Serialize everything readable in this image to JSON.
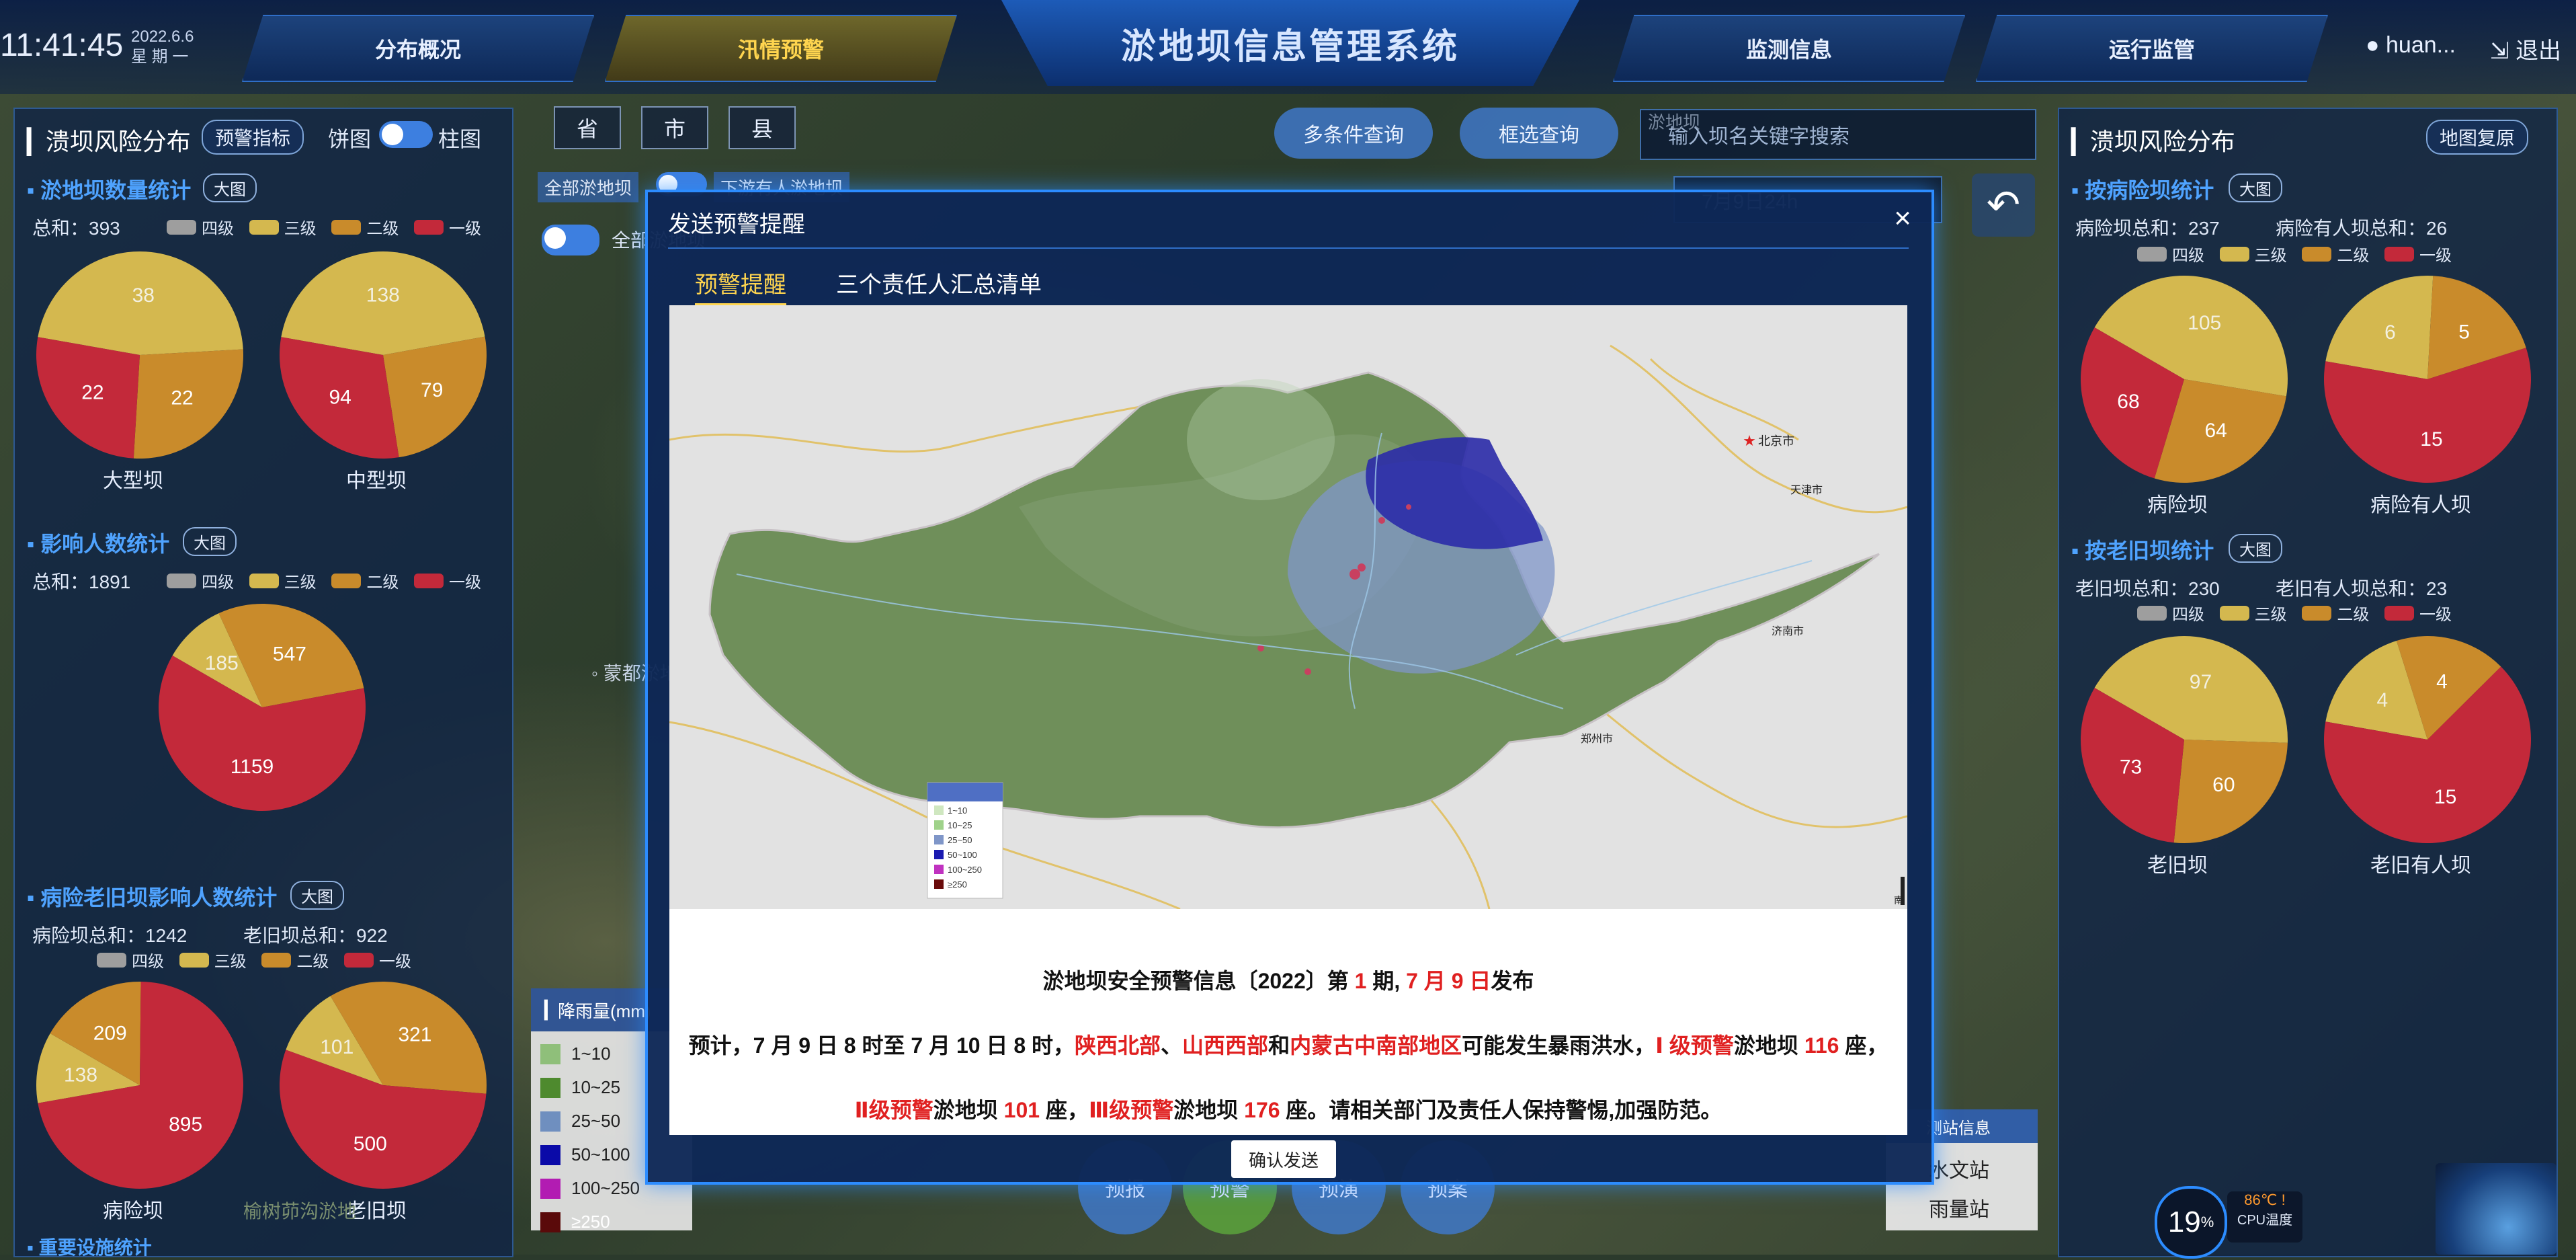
{
  "header": {
    "time": "11:41:45",
    "date": "2022.6.6",
    "weekday": "星 期 一",
    "system_title": "淤地坝信息管理系统",
    "nav": [
      "分布概况",
      "汛情预警",
      "监测信息",
      "运行监管"
    ],
    "user": "huan...",
    "logout": "退出"
  },
  "colors": {
    "level4": "#9e9e9e",
    "level3": "#d4b84f",
    "level2": "#c98b2b",
    "level1": "#c3293a",
    "accent": "#2c8cff"
  },
  "levels": [
    "四级",
    "三级",
    "二级",
    "一级"
  ],
  "left": {
    "title": "溃坝风险分布",
    "indicator_button": "预警指标",
    "toggle_left": "饼图",
    "toggle_right": "柱图",
    "dam_count": {
      "title": "淤地坝数量统计",
      "big": "大图",
      "total": "总和：393",
      "pies": [
        {
          "label": "大型坝",
          "values": [
            38,
            22,
            22
          ]
        },
        {
          "label": "中型坝",
          "values": [
            138,
            79,
            94
          ]
        }
      ]
    },
    "people": {
      "title": "影响人数统计",
      "big": "大图",
      "total": "总和：1891",
      "values": [
        185,
        547,
        1159
      ]
    },
    "old_people": {
      "title": "病险老旧坝影响人数统计",
      "big": "大图",
      "total1": "病险坝总和：1242",
      "total2": "老旧坝总和：922",
      "pies": [
        {
          "label": "病险坝",
          "values": [
            138,
            209,
            895
          ]
        },
        {
          "label": "老旧坝",
          "values": [
            101,
            321,
            500
          ]
        }
      ]
    },
    "next_section": "重要设施统计"
  },
  "middle": {
    "region_tabs": [
      "省",
      "市",
      "县"
    ],
    "multi_query": "多条件查询",
    "frame_query": "框选查询",
    "search_placeholder": "输入坝名关键字搜索",
    "all_dams": "全部淤地坝",
    "downstream": "下游有人淤地坝",
    "all_dams2": "全部淤地坝",
    "time_filter": "7月9日24h",
    "hidden_label": "淤地坝",
    "dam_label": "淤地坝"
  },
  "modal": {
    "title": "发送预警提醒",
    "close": "×",
    "tab1": "预警提醒",
    "tab2": "三个责任人汇总清单",
    "map_labels": {
      "beijing": "北京市",
      "tianjin": "天津市",
      "jinan": "济南市",
      "zhengzhou": "郑州市",
      "south": "南"
    },
    "map_legend": [
      "1~10",
      "10~25",
      "25~50",
      "50~100",
      "100~250",
      "≥250"
    ],
    "line1": {
      "a": "淤地坝安全预警信息〔2022〕第 ",
      "b": "1",
      "c": " 期, ",
      "d": "7 月 9 日",
      "e": "发布"
    },
    "line2": {
      "a": "预计，7 月 9 日 8 时至 7 月 10 日 8 时，",
      "b": "陕西北部",
      "c": "、",
      "d": "山西西部",
      "e": "和",
      "f": "内蒙古中南部地区",
      "g": "可能发生暴雨洪水，",
      "h": "Ⅰ 级预警",
      "i": "淤地坝 ",
      "j": "116",
      "k": " 座，"
    },
    "line3": {
      "a": "Ⅱ级预警",
      "b": "淤地坝 ",
      "c": "101",
      "d": " 座，",
      "e": "Ⅲ级预警",
      "f": "淤地坝 ",
      "g": "176",
      "h": " 座。请相关部门及责任人保持警惕,加强防范。"
    },
    "confirm": "确认发送"
  },
  "rain_legend": {
    "title": "降雨量(mm)",
    "items": [
      {
        "label": "1~10",
        "color": "#8fbf7a"
      },
      {
        "label": "10~25",
        "color": "#4e8a2e"
      },
      {
        "label": "25~50",
        "color": "#6f8fbf"
      },
      {
        "label": "50~100",
        "color": "#0a0aa8"
      },
      {
        "label": "100~250",
        "color": "#b21cb2"
      },
      {
        "label": "≥250",
        "color": "#5a0a0a"
      }
    ]
  },
  "bottom_buttons": [
    "预报",
    "预警",
    "预演",
    "预案"
  ],
  "stations": {
    "title": "测站信息",
    "items": [
      "水文站",
      "雨量站"
    ]
  },
  "bottom_left_label": "榆树茆沟淤地",
  "map_place": "蒙都淤地",
  "right": {
    "title": "溃坝风险分布",
    "restore": "地图复原",
    "risk": {
      "title": "按病险坝统计",
      "big": "大图",
      "total1": "病险坝总和：237",
      "total2": "病险有人坝总和：26",
      "pies": [
        {
          "label": "病险坝",
          "values": [
            105,
            64,
            68
          ]
        },
        {
          "label": "病险有人坝",
          "values": [
            6,
            5,
            15
          ]
        }
      ]
    },
    "old": {
      "title": "按老旧坝统计",
      "big": "大图",
      "total1": "老旧坝总和：230",
      "total2": "老旧有人坝总和：23",
      "pies": [
        {
          "label": "老旧坝",
          "values": [
            97,
            60,
            73
          ]
        },
        {
          "label": "老旧有人坝",
          "values": [
            4,
            4,
            15
          ]
        }
      ]
    }
  },
  "cpu": {
    "percent": "19",
    "unit": "%",
    "temp": "86℃",
    "label": "CPU温度"
  }
}
